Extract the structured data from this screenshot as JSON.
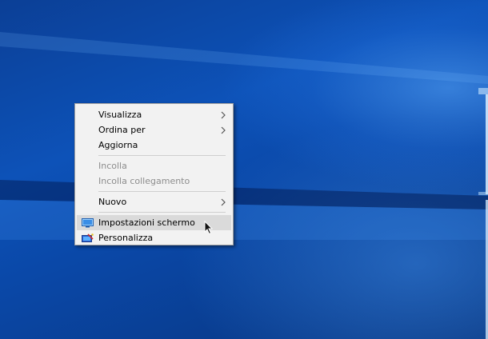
{
  "context_menu": {
    "view_label": "Visualizza",
    "sort_label": "Ordina per",
    "refresh_label": "Aggiorna",
    "paste_label": "Incolla",
    "paste_link_label": "Incolla collegamento",
    "new_label": "Nuovo",
    "display_settings_label": "Impostazioni schermo",
    "personalize_label": "Personalizza"
  },
  "icons": {
    "view_arrow": "chevron-right-icon",
    "sort_arrow": "chevron-right-icon",
    "new_arrow": "chevron-right-icon",
    "display_settings": "monitor-icon",
    "personalize": "personalize-icon",
    "cursor": "mouse-pointer-icon"
  },
  "colors": {
    "desktop_blue": "#0d52b8",
    "menu_background": "#f2f2f2",
    "hover_background": "#dadada",
    "disabled_text": "#8d8d8d"
  }
}
